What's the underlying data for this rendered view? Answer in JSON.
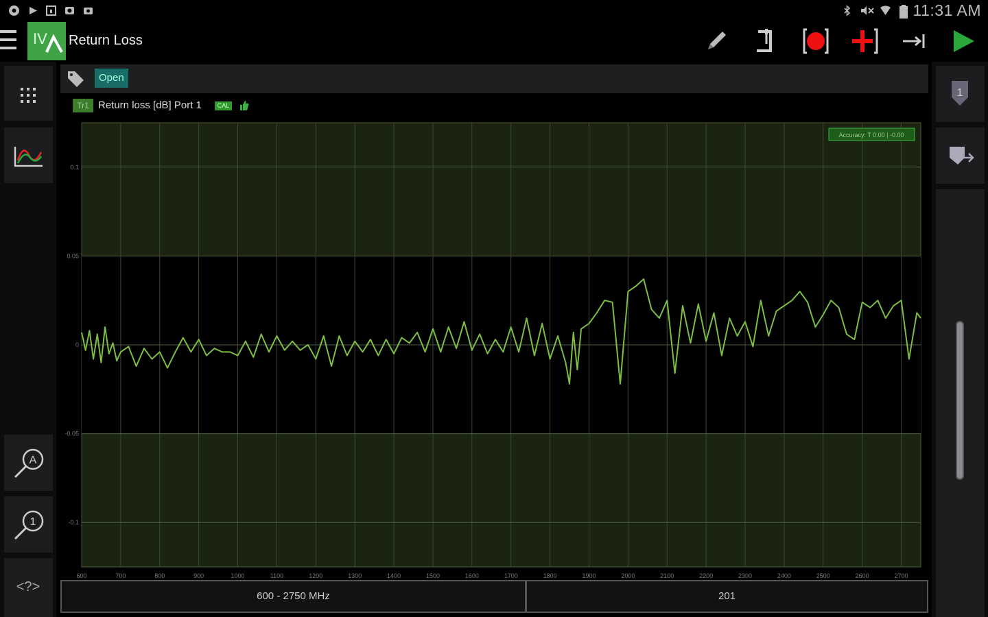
{
  "status_bar": {
    "time": "11:31 AM",
    "left_icons": [
      "chrome-icon",
      "play-store-icon",
      "calendar-icon",
      "gallery-icon",
      "camera-icon"
    ],
    "right_icons": [
      "bluetooth-icon",
      "mute-icon",
      "wifi-icon",
      "battery-icon"
    ]
  },
  "action_bar": {
    "logo_text": "IV",
    "title": "Return Loss",
    "actions": [
      "edit-icon",
      "marker-icon",
      "record-icon",
      "add-icon",
      "arrow-icon",
      "play-icon"
    ]
  },
  "tag_bar": {
    "chip_label": "Open"
  },
  "trace": {
    "badge": "Tr1",
    "title": "Return loss [dB] Port 1",
    "cal_badge": "CAL",
    "accuracy_label": "Accuracy: T 0.00 | -0.00"
  },
  "chart_data": {
    "type": "line",
    "title": "",
    "xlabel": "",
    "ylabel": "",
    "xlim": [
      600,
      2750
    ],
    "ylim": [
      -0.125,
      0.125
    ],
    "x_ticks": [
      "600",
      "700",
      "800",
      "900",
      "1000",
      "1100",
      "1200",
      "1300",
      "1400",
      "1500",
      "1600",
      "1700",
      "1800",
      "1900",
      "2000",
      "2100",
      "2200",
      "2300",
      "2400",
      "2500",
      "2600",
      "2700"
    ],
    "y_ticks": [
      "0.1",
      "0.05",
      "0",
      "-0.05",
      "-0.1"
    ],
    "y_tick_values": [
      0.1,
      0.05,
      0,
      -0.05,
      -0.1
    ],
    "limit_band": [
      -0.05,
      0.05
    ],
    "grid": true,
    "colors": {
      "trace": "#7dbd44",
      "band": "#1a2410",
      "inside": "#000000",
      "grid": "#3a4a2a"
    },
    "series": [
      {
        "x": [
          600,
          610,
          620,
          630,
          640,
          650,
          660,
          670,
          680,
          690,
          700,
          720,
          740,
          760,
          780,
          800,
          820,
          840,
          860,
          880,
          900,
          920,
          940,
          960,
          980,
          1000,
          1020,
          1040,
          1060,
          1080,
          1100,
          1120,
          1140,
          1160,
          1180,
          1200,
          1220,
          1240,
          1260,
          1280,
          1300,
          1320,
          1340,
          1360,
          1380,
          1400,
          1420,
          1440,
          1460,
          1480,
          1500,
          1520,
          1540,
          1560,
          1580,
          1600,
          1620,
          1640,
          1660,
          1680,
          1700,
          1720,
          1740,
          1760,
          1780,
          1800,
          1820,
          1840,
          1850,
          1860,
          1870,
          1880,
          1900,
          1920,
          1940,
          1960,
          1980,
          2000,
          2020,
          2040,
          2060,
          2080,
          2100,
          2120,
          2140,
          2160,
          2180,
          2200,
          2220,
          2240,
          2260,
          2280,
          2300,
          2320,
          2340,
          2360,
          2380,
          2400,
          2420,
          2440,
          2460,
          2480,
          2500,
          2520,
          2540,
          2560,
          2580,
          2600,
          2620,
          2640,
          2660,
          2680,
          2700,
          2720,
          2740,
          2750
        ],
        "y": [
          0.007,
          -0.003,
          0.008,
          -0.008,
          0.006,
          -0.01,
          0.01,
          -0.005,
          0.001,
          -0.009,
          -0.004,
          -0.001,
          -0.012,
          -0.002,
          -0.008,
          -0.004,
          -0.013,
          -0.004,
          0.004,
          -0.004,
          0.003,
          -0.006,
          -0.002,
          -0.004,
          -0.004,
          -0.006,
          0.002,
          -0.007,
          0.006,
          -0.004,
          0.005,
          -0.003,
          0.002,
          -0.003,
          0.0,
          -0.008,
          0.005,
          -0.012,
          0.005,
          -0.006,
          0.002,
          -0.004,
          0.003,
          -0.006,
          0.003,
          -0.005,
          0.004,
          0.001,
          0.007,
          -0.004,
          0.009,
          -0.004,
          0.01,
          -0.002,
          0.013,
          -0.003,
          0.006,
          -0.005,
          0.003,
          -0.004,
          0.01,
          -0.004,
          0.015,
          -0.006,
          0.012,
          -0.008,
          0.005,
          -0.01,
          -0.022,
          0.007,
          -0.014,
          0.009,
          0.012,
          0.018,
          0.025,
          0.024,
          -0.022,
          0.03,
          0.033,
          0.037,
          0.02,
          0.015,
          0.025,
          -0.016,
          0.022,
          0.001,
          0.023,
          0.002,
          0.018,
          -0.006,
          0.015,
          0.005,
          0.013,
          -0.001,
          0.025,
          0.005,
          0.019,
          0.022,
          0.025,
          0.03,
          0.024,
          0.01,
          0.017,
          0.025,
          0.021,
          0.006,
          0.003,
          0.024,
          0.021,
          0.025,
          0.015,
          0.022,
          0.025,
          -0.008,
          0.018,
          0.015
        ]
      }
    ]
  },
  "footer": {
    "range": "600 - 2750 MHz",
    "points": "201"
  }
}
